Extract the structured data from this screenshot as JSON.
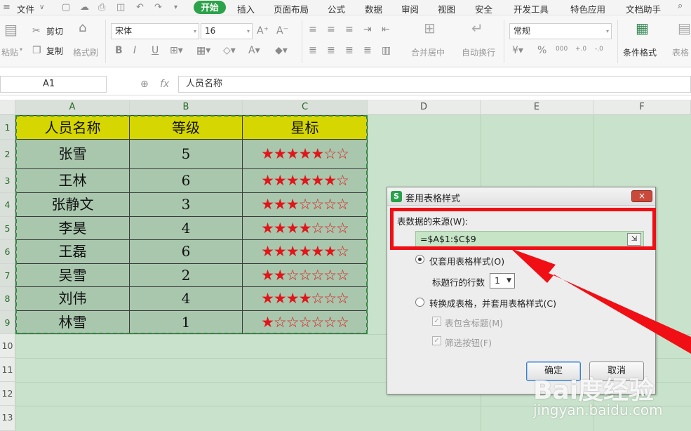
{
  "menubar": {
    "file": "文件",
    "file_arrow": "∨",
    "start": "开始",
    "items": [
      "插入",
      "页面布局",
      "公式",
      "数据",
      "审阅",
      "视图",
      "安全",
      "开发工具",
      "特色应用",
      "文档助手"
    ]
  },
  "ribbon": {
    "paste": "粘贴",
    "cut": "剪切",
    "copy": "复制",
    "format_painter": "格式刷",
    "font_name": "宋体",
    "font_size": "16",
    "merge_center": "合并居中",
    "wrap_text": "自动换行",
    "number_format": "常规",
    "conditional_format": "条件格式",
    "table_style": "表格"
  },
  "formula_bar": {
    "cell_ref": "A1",
    "fx": "fx",
    "content": "人员名称"
  },
  "columns": [
    "A",
    "B",
    "C",
    "D",
    "E",
    "F"
  ],
  "rows": [
    "1",
    "2",
    "3",
    "4",
    "5",
    "6",
    "7",
    "8",
    "9",
    "10",
    "11",
    "12",
    "13"
  ],
  "table": {
    "headers": [
      "人员名称",
      "等级",
      "星标"
    ],
    "rows": [
      {
        "name": "张雪",
        "level": "5",
        "stars": "★★★★★☆☆"
      },
      {
        "name": "王林",
        "level": "6",
        "stars": "★★★★★★☆"
      },
      {
        "name": "张静文",
        "level": "3",
        "stars": "★★★☆☆☆☆"
      },
      {
        "name": "李昊",
        "level": "4",
        "stars": "★★★★☆☆☆"
      },
      {
        "name": "王磊",
        "level": "6",
        "stars": "★★★★★★☆"
      },
      {
        "name": "吴雪",
        "level": "2",
        "stars": "★★☆☆☆☆☆"
      },
      {
        "name": "刘伟",
        "level": "4",
        "stars": "★★★★☆☆☆"
      },
      {
        "name": "林雪",
        "level": "1",
        "stars": "★☆☆☆☆☆☆"
      }
    ]
  },
  "dialog": {
    "title": "套用表格样式",
    "close": "×",
    "source_label": "表数据的来源(W):",
    "range": "=$A$1:$C$9",
    "option1": "仅套用表格样式(O)",
    "header_rows_label": "标题行的行数",
    "header_rows_value": "1",
    "option2": "转换成表格，并套用表格样式(C)",
    "check_header": "表包含标题(M)",
    "check_filter": "筛选按钮(F)",
    "ok": "确定",
    "cancel": "取消"
  },
  "watermark": {
    "brand": "Bai度经验",
    "url": "jingyan.baidu.com"
  },
  "colors": {
    "header_fill": "#d6d600",
    "body_fill": "#a8c7ad",
    "star": "#e1161a",
    "highlight": "#f00f14",
    "start_tab": "#2ca34a"
  }
}
